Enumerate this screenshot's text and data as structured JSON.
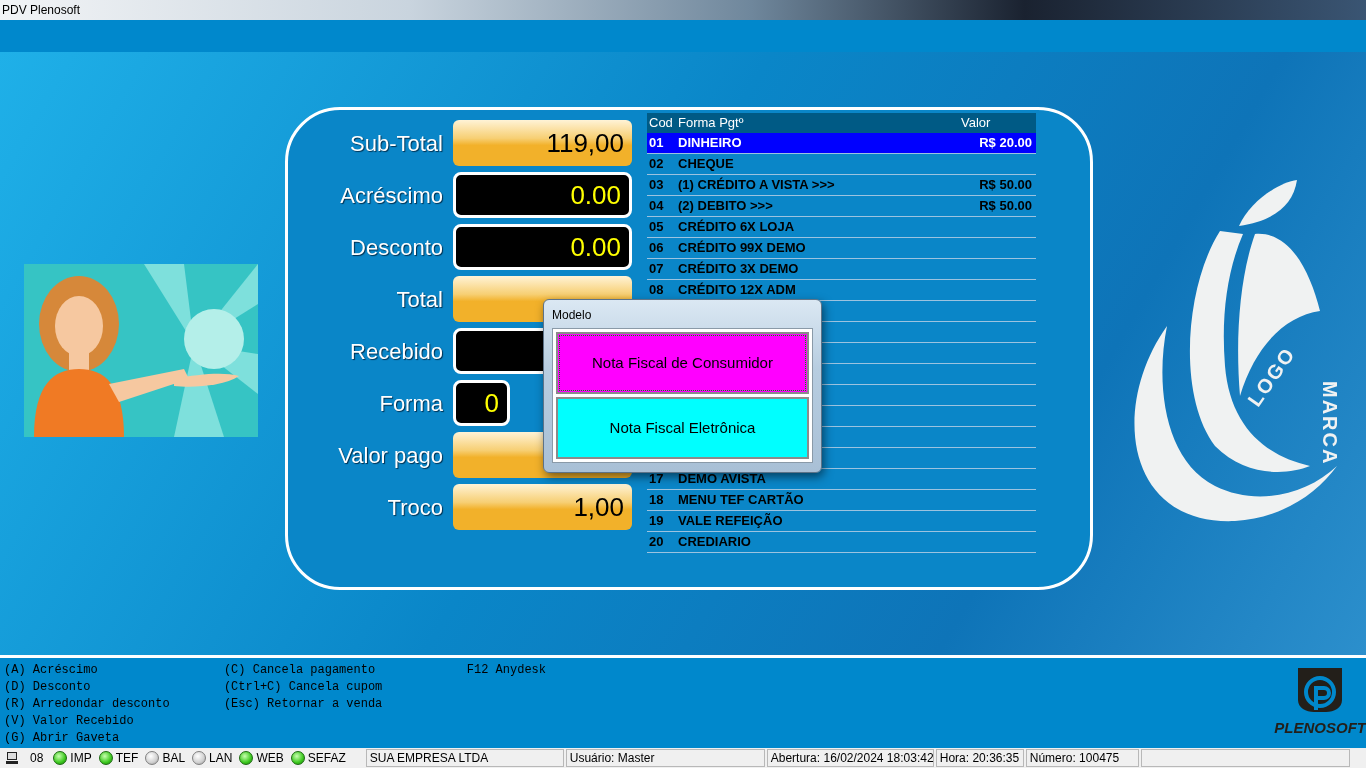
{
  "window": {
    "title": "PDV Plenosoft"
  },
  "totals": [
    {
      "label": "Sub-Total",
      "value": "119,00",
      "kind": "gold"
    },
    {
      "label": "Acréscimo",
      "value": "0.00",
      "kind": "dark"
    },
    {
      "label": "Desconto",
      "value": "0.00",
      "kind": "dark"
    },
    {
      "label": "Total",
      "kind": "gold"
    },
    {
      "label": "Recebido",
      "kind": "dark"
    },
    {
      "label": "Forma",
      "value": "0",
      "kind": "code"
    },
    {
      "label": "Valor pago",
      "kind": "gold"
    },
    {
      "label": "Troco",
      "value": "1,00",
      "kind": "gold"
    }
  ],
  "payments": {
    "columns": [
      "Cod",
      "Forma Pgtº",
      "Valor"
    ],
    "rows": [
      {
        "kind": "entry",
        "code": "01",
        "name": "DINHEIRO",
        "value": "R$ 20.00",
        "selected": true
      },
      {
        "kind": "entry",
        "code": "02",
        "name": "CHEQUE",
        "selected": false
      },
      {
        "kind": "entry",
        "code": "03",
        "name": "(1) CRÉDITO A VISTA >>>",
        "value": "R$ 50.00",
        "selected": false
      },
      {
        "kind": "entry",
        "code": "04",
        "name": "(2) DEBITO >>>",
        "value": "R$ 50.00",
        "selected": false
      },
      {
        "kind": "entry",
        "code": "05",
        "name": "CRÉDITO 6X LOJA",
        "selected": false
      },
      {
        "kind": "entry",
        "code": "06",
        "name": "CRÉDITO 99X DEMO",
        "selected": false
      },
      {
        "kind": "entry",
        "code": "07",
        "name": "CRÉDITO 3X DEMO",
        "selected": false
      },
      {
        "kind": "entry",
        "code": "08",
        "name": "CRÉDITO 12X ADM",
        "selected": false
      },
      {
        "kind": "covered"
      },
      {
        "kind": "covered"
      },
      {
        "kind": "covered"
      },
      {
        "kind": "covered"
      },
      {
        "kind": "covered"
      },
      {
        "kind": "covered"
      },
      {
        "kind": "covered"
      },
      {
        "kind": "covered"
      },
      {
        "kind": "entry",
        "code": "17",
        "name": "DEMO AVISTA",
        "selected": false
      },
      {
        "kind": "entry",
        "code": "18",
        "name": "MENU TEF CARTÃO",
        "selected": false
      },
      {
        "kind": "entry",
        "code": "19",
        "name": "VALE REFEIÇÃO",
        "selected": false
      },
      {
        "kind": "entry",
        "code": "20",
        "name": "CREDIARIO",
        "selected": false
      }
    ]
  },
  "dialog": {
    "title": "Modelo",
    "options": [
      {
        "label": "Nota Fiscal de Consumidor",
        "color": "#ff00ff",
        "focused": true
      },
      {
        "label": "Nota Fiscal Eletrônica",
        "color": "#00ffff",
        "focused": false
      }
    ]
  },
  "logo": {
    "words": [
      "LOGO",
      "MARCA"
    ]
  },
  "shortcuts": [
    [
      "(A) Acréscimo",
      "(D) Desconto",
      "(R) Arredondar desconto",
      "(V) Valor Recebido",
      "(G) Abrir Gaveta"
    ],
    [
      "(C) Cancela pagamento",
      "(Ctrl+C) Cancela cupom",
      "(Esc) Retornar a venda"
    ],
    [
      "F12 Anydesk"
    ]
  ],
  "brand": "PLENOSOFT",
  "status_bar": {
    "terminal": "08",
    "indicators": [
      {
        "label": "IMP",
        "on": true
      },
      {
        "label": "TEF",
        "on": true
      },
      {
        "label": "BAL",
        "on": false
      },
      {
        "label": "LAN",
        "on": false
      },
      {
        "label": "WEB",
        "on": true
      },
      {
        "label": "SEFAZ",
        "on": true
      }
    ],
    "panels": [
      "SUA EMPRESA LTDA",
      "Usuário: Master",
      "Abertura: 16/02/2024 18:03:42",
      "Hora: 20:36:35",
      "Número: 100475"
    ]
  }
}
